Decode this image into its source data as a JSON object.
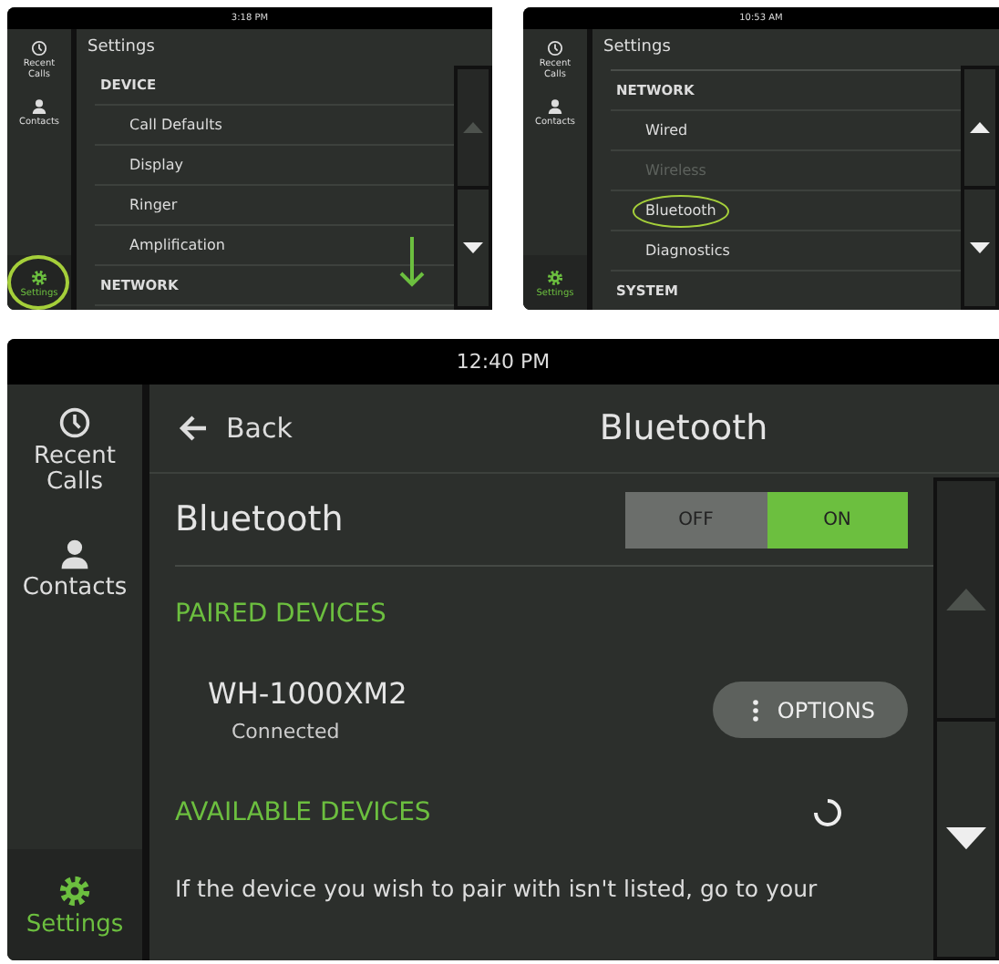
{
  "screens": [
    {
      "kind": "menu",
      "time": "3:18 PM",
      "nav": [
        {
          "kind": "recent",
          "label": "Recent Calls",
          "selected": false,
          "circled": false
        },
        {
          "kind": "contacts",
          "label": "Contacts",
          "selected": false,
          "circled": false
        },
        {
          "kind": "settings",
          "label": "Settings",
          "selected": true,
          "circled": true
        }
      ],
      "title": "Settings",
      "items": [
        {
          "kind": "section",
          "label": "DEVICE"
        },
        {
          "kind": "item",
          "label": "Call Defaults",
          "disabled": false,
          "circled": false
        },
        {
          "kind": "item",
          "label": "Display",
          "disabled": false,
          "circled": false
        },
        {
          "kind": "item",
          "label": "Ringer",
          "disabled": false,
          "circled": false
        },
        {
          "kind": "item",
          "label": "Amplification",
          "disabled": false,
          "circled": false
        },
        {
          "kind": "section",
          "label": "NETWORK"
        }
      ],
      "scroll_arrow": true,
      "scroll": {
        "up_disabled": true,
        "down_disabled": false
      }
    },
    {
      "kind": "menu",
      "time": "10:53 AM",
      "nav": [
        {
          "kind": "recent",
          "label": "Recent Calls",
          "selected": false,
          "circled": false
        },
        {
          "kind": "contacts",
          "label": "Contacts",
          "selected": false,
          "circled": false
        },
        {
          "kind": "settings",
          "label": "Settings",
          "selected": true,
          "circled": false
        }
      ],
      "title": "Settings",
      "top_divider": true,
      "items": [
        {
          "kind": "section",
          "label": "NETWORK"
        },
        {
          "kind": "item",
          "label": "Wired",
          "disabled": false,
          "circled": false
        },
        {
          "kind": "item",
          "label": "Wireless",
          "disabled": true,
          "circled": false
        },
        {
          "kind": "item",
          "label": "Bluetooth",
          "disabled": false,
          "circled": true
        },
        {
          "kind": "item",
          "label": "Diagnostics",
          "disabled": false,
          "circled": false
        },
        {
          "kind": "section",
          "label": "SYSTEM"
        }
      ],
      "scroll": {
        "up_disabled": false,
        "down_disabled": false
      }
    },
    {
      "kind": "detail",
      "time": "12:40 PM",
      "nav": [
        {
          "kind": "recent",
          "label": "Recent Calls",
          "selected": false,
          "circled": false
        },
        {
          "kind": "contacts",
          "label": "Contacts",
          "selected": false,
          "circled": false
        },
        {
          "kind": "settings",
          "label": "Settings",
          "selected": true,
          "circled": false
        }
      ],
      "back": "Back",
      "title": "Bluetooth",
      "toggle": {
        "label": "Bluetooth",
        "off": "OFF",
        "on_label": "ON",
        "on": true
      },
      "paired": {
        "heading": "PAIRED DEVICES",
        "devices": [
          {
            "name": "WH-1000XM2",
            "status": "Connected",
            "button": "OPTIONS"
          }
        ]
      },
      "available": {
        "heading": "AVAILABLE DEVICES",
        "searching": true
      },
      "help": "If the device you wish to pair with isn't listed, go to your",
      "scroll": {
        "up_disabled": true,
        "down_disabled": false
      }
    }
  ]
}
